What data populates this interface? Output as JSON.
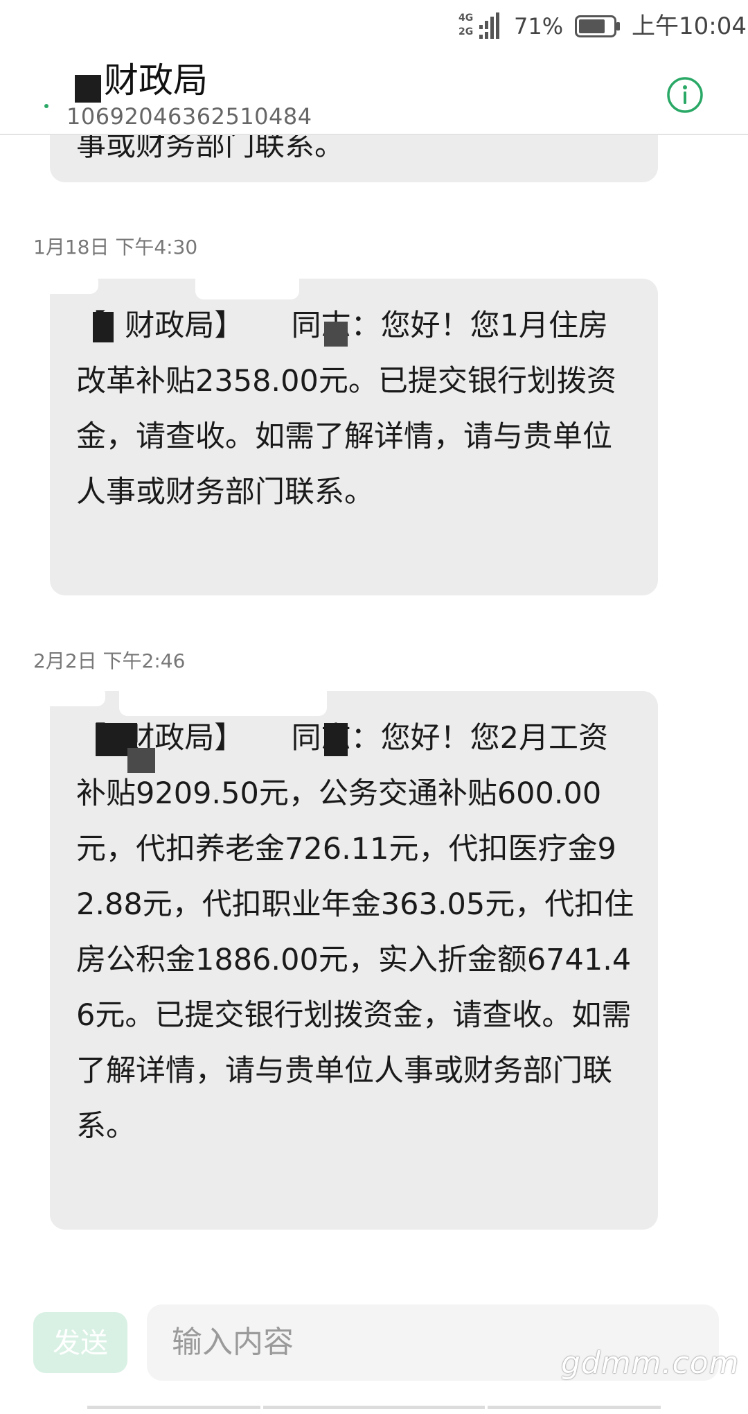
{
  "status_bar": {
    "network_1": "4G",
    "network_2": "2G",
    "battery": "71%",
    "time": "上午10:04"
  },
  "header": {
    "contact_name": "财政局",
    "contact_number": "1069204636251048­4",
    "info_icon": "info-circle-icon"
  },
  "messages": {
    "top_partial": "事或财务部门联系。",
    "m1": {
      "timestamp": "1月18日 下午4:30",
      "text": "【  财政局】     同志：您好！您1月住房改革补贴2358.00元。已提交银行划拨资金，请查收。如需了解详情，请与贵单位人事或财务部门联系。"
    },
    "m2": {
      "timestamp": "2月2日 下午2:46",
      "text": "【  财政局】     同志：您好！您2月工资补贴9209.50元，公务交通补贴600.00元，代扣养老金726.11元，代扣医疗金92.88元，代扣职业年金363.05元，代扣住房公积金1886.00元，实入折金额6741.46元。已提交银行划拨资金，请查收。如需了解详情，请与贵单位人事或财务部门联系。"
    }
  },
  "composer": {
    "send_label": "发送",
    "placeholder": "输入内容"
  },
  "watermark": "gdmm.com",
  "colors": {
    "accent": "#2aa866",
    "bubble": "#ececec",
    "send_disabled": "#d9f1e4"
  }
}
